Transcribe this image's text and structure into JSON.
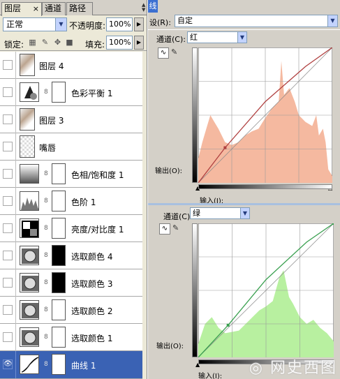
{
  "layers_panel": {
    "tabs": [
      {
        "label": "图层",
        "close": "×"
      },
      {
        "label": "通道"
      },
      {
        "label": "路径"
      }
    ],
    "blend_mode": "正常",
    "opacity_label": "不透明度:",
    "opacity_value": "100%",
    "lock_label": "锁定:",
    "fill_label": "填充:",
    "fill_value": "100%",
    "layers": [
      {
        "name": "图层 4",
        "visible": false,
        "selected": false
      },
      {
        "name": "色彩平衡 1",
        "visible": false,
        "selected": false
      },
      {
        "name": "图层 3",
        "visible": false,
        "selected": false
      },
      {
        "name": "嘴唇",
        "visible": false,
        "selected": false
      },
      {
        "name": "色相/饱和度 1",
        "visible": false,
        "selected": false
      },
      {
        "name": "色阶 1",
        "visible": false,
        "selected": false
      },
      {
        "name": "亮度/对比度 1",
        "visible": false,
        "selected": false
      },
      {
        "name": "选取颜色 4",
        "visible": false,
        "selected": false
      },
      {
        "name": "选取颜色 3",
        "visible": false,
        "selected": false
      },
      {
        "name": "选取颜色 2",
        "visible": false,
        "selected": false
      },
      {
        "name": "选取颜色 1",
        "visible": false,
        "selected": false
      },
      {
        "name": "曲线 1",
        "visible": true,
        "selected": true
      }
    ]
  },
  "curves": {
    "title_fragment": "线",
    "preset_label": "设(R):",
    "preset_value": "自定",
    "red": {
      "channel_label": "通道(C):",
      "channel_value": "红",
      "output_label": "输出(O):",
      "input_label": "输入(I):",
      "histogram_color": "#f5b9a0",
      "curve_color": "#b04040"
    },
    "green": {
      "channel_label": "通道(C):",
      "channel_value": "绿",
      "output_label": "输出(O):",
      "input_label": "输入(I):",
      "histogram_color": "#b8f0a0",
      "curve_color": "#3aa050"
    }
  }
}
